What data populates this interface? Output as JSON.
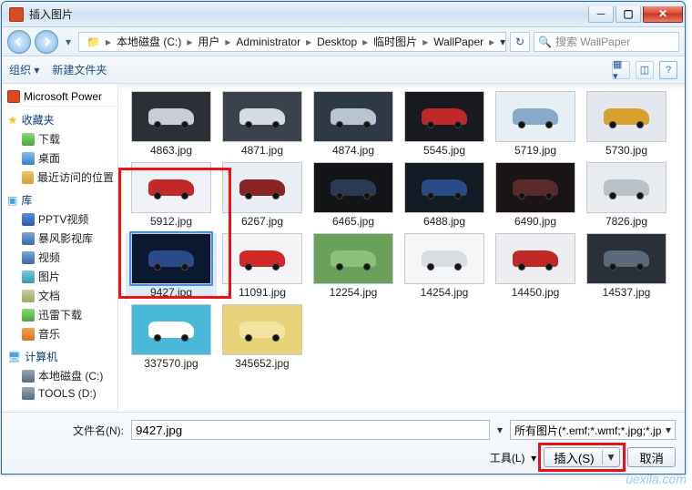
{
  "title": "插入图片",
  "breadcrumb": [
    "本地磁盘 (C:)",
    "用户",
    "Administrator",
    "Desktop",
    "临时图片",
    "WallPaper"
  ],
  "search_placeholder": "搜索 WallPaper",
  "toolbar": {
    "organize": "组织",
    "newfolder": "新建文件夹"
  },
  "recent_app": "Microsoft Power",
  "sidebar": {
    "fav_head": "收藏夹",
    "fav": [
      "下载",
      "桌面",
      "最近访问的位置"
    ],
    "lib_head": "库",
    "lib": [
      "PPTV视频",
      "暴风影视库",
      "视频",
      "图片",
      "文档",
      "迅雷下载",
      "音乐"
    ],
    "pc_head": "计算机",
    "pc": [
      "本地磁盘 (C:)",
      "TOOLS (D:)"
    ]
  },
  "files": [
    {
      "name": "4863.jpg",
      "bg": "#2b3036",
      "car": "#c8cfd8"
    },
    {
      "name": "4871.jpg",
      "bg": "#3a434c",
      "car": "#d4dbe4"
    },
    {
      "name": "4874.jpg",
      "bg": "#2f3946",
      "car": "#b8c4d4"
    },
    {
      "name": "5545.jpg",
      "bg": "#181a20",
      "car": "#c02828"
    },
    {
      "name": "5719.jpg",
      "bg": "#e6eef6",
      "car": "#8aa8c8"
    },
    {
      "name": "5730.jpg",
      "bg": "#e4e8ee",
      "car": "#d6a02a"
    },
    {
      "name": "5912.jpg",
      "bg": "#eef1f5",
      "car": "#c22828"
    },
    {
      "name": "6267.jpg",
      "bg": "#e8eef4",
      "car": "#8a2424"
    },
    {
      "name": "6465.jpg",
      "bg": "#121418",
      "car": "#2a3a52"
    },
    {
      "name": "6488.jpg",
      "bg": "#121a24",
      "car": "#2a4a8a"
    },
    {
      "name": "6490.jpg",
      "bg": "#1a1416",
      "car": "#5a2a2a"
    },
    {
      "name": "7826.jpg",
      "bg": "#e8ecf0",
      "car": "#b8c0c8"
    },
    {
      "name": "9427.jpg",
      "bg": "#0a1832",
      "car": "#2a4a8a",
      "selected": true
    },
    {
      "name": "11091.jpg",
      "bg": "#f2f4f6",
      "car": "#d02828"
    },
    {
      "name": "12254.jpg",
      "bg": "#6aa05a",
      "car": "#8ac27a"
    },
    {
      "name": "14254.jpg",
      "bg": "#f4f6f8",
      "car": "#d8dde4"
    },
    {
      "name": "14450.jpg",
      "bg": "#eceef2",
      "car": "#c02828"
    },
    {
      "name": "14537.jpg",
      "bg": "#2a3038",
      "car": "#5a6a7a"
    },
    {
      "name": "337570.jpg",
      "bg": "#4ab8d8",
      "car": "#ffffff"
    },
    {
      "name": "345652.jpg",
      "bg": "#e8d27a",
      "car": "#f4e4a0"
    }
  ],
  "footer": {
    "filename_label": "文件名(N):",
    "filename_value": "9427.jpg",
    "filter": "所有图片(*.emf;*.wmf;*.jpg;*.jp",
    "tools": "工具(L)",
    "insert": "插入(S)",
    "cancel": "取消"
  },
  "watermark": "uexila.com"
}
